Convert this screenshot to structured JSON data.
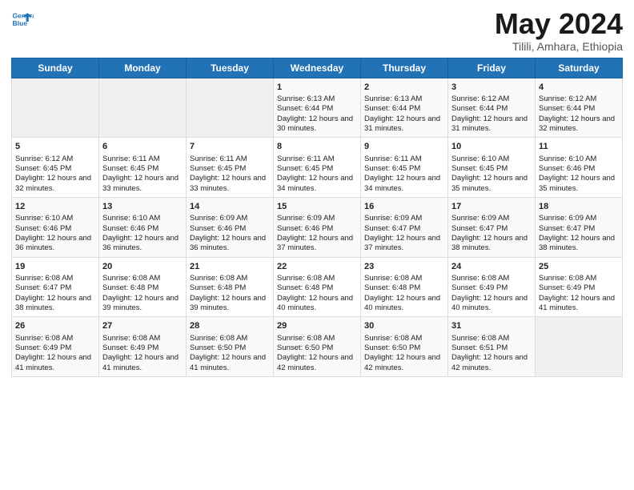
{
  "logo": {
    "line1": "General",
    "line2": "Blue"
  },
  "title": "May 2024",
  "subtitle": "Tilili, Amhara, Ethiopia",
  "days_of_week": [
    "Sunday",
    "Monday",
    "Tuesday",
    "Wednesday",
    "Thursday",
    "Friday",
    "Saturday"
  ],
  "weeks": [
    [
      {
        "day": null,
        "content": null
      },
      {
        "day": null,
        "content": null
      },
      {
        "day": null,
        "content": null
      },
      {
        "day": "1",
        "content": "Sunrise: 6:13 AM\nSunset: 6:44 PM\nDaylight: 12 hours and 30 minutes."
      },
      {
        "day": "2",
        "content": "Sunrise: 6:13 AM\nSunset: 6:44 PM\nDaylight: 12 hours and 31 minutes."
      },
      {
        "day": "3",
        "content": "Sunrise: 6:12 AM\nSunset: 6:44 PM\nDaylight: 12 hours and 31 minutes."
      },
      {
        "day": "4",
        "content": "Sunrise: 6:12 AM\nSunset: 6:44 PM\nDaylight: 12 hours and 32 minutes."
      }
    ],
    [
      {
        "day": "5",
        "content": "Sunrise: 6:12 AM\nSunset: 6:45 PM\nDaylight: 12 hours and 32 minutes."
      },
      {
        "day": "6",
        "content": "Sunrise: 6:11 AM\nSunset: 6:45 PM\nDaylight: 12 hours and 33 minutes."
      },
      {
        "day": "7",
        "content": "Sunrise: 6:11 AM\nSunset: 6:45 PM\nDaylight: 12 hours and 33 minutes."
      },
      {
        "day": "8",
        "content": "Sunrise: 6:11 AM\nSunset: 6:45 PM\nDaylight: 12 hours and 34 minutes."
      },
      {
        "day": "9",
        "content": "Sunrise: 6:11 AM\nSunset: 6:45 PM\nDaylight: 12 hours and 34 minutes."
      },
      {
        "day": "10",
        "content": "Sunrise: 6:10 AM\nSunset: 6:45 PM\nDaylight: 12 hours and 35 minutes."
      },
      {
        "day": "11",
        "content": "Sunrise: 6:10 AM\nSunset: 6:46 PM\nDaylight: 12 hours and 35 minutes."
      }
    ],
    [
      {
        "day": "12",
        "content": "Sunrise: 6:10 AM\nSunset: 6:46 PM\nDaylight: 12 hours and 36 minutes."
      },
      {
        "day": "13",
        "content": "Sunrise: 6:10 AM\nSunset: 6:46 PM\nDaylight: 12 hours and 36 minutes."
      },
      {
        "day": "14",
        "content": "Sunrise: 6:09 AM\nSunset: 6:46 PM\nDaylight: 12 hours and 36 minutes."
      },
      {
        "day": "15",
        "content": "Sunrise: 6:09 AM\nSunset: 6:46 PM\nDaylight: 12 hours and 37 minutes."
      },
      {
        "day": "16",
        "content": "Sunrise: 6:09 AM\nSunset: 6:47 PM\nDaylight: 12 hours and 37 minutes."
      },
      {
        "day": "17",
        "content": "Sunrise: 6:09 AM\nSunset: 6:47 PM\nDaylight: 12 hours and 38 minutes."
      },
      {
        "day": "18",
        "content": "Sunrise: 6:09 AM\nSunset: 6:47 PM\nDaylight: 12 hours and 38 minutes."
      }
    ],
    [
      {
        "day": "19",
        "content": "Sunrise: 6:08 AM\nSunset: 6:47 PM\nDaylight: 12 hours and 38 minutes."
      },
      {
        "day": "20",
        "content": "Sunrise: 6:08 AM\nSunset: 6:48 PM\nDaylight: 12 hours and 39 minutes."
      },
      {
        "day": "21",
        "content": "Sunrise: 6:08 AM\nSunset: 6:48 PM\nDaylight: 12 hours and 39 minutes."
      },
      {
        "day": "22",
        "content": "Sunrise: 6:08 AM\nSunset: 6:48 PM\nDaylight: 12 hours and 40 minutes."
      },
      {
        "day": "23",
        "content": "Sunrise: 6:08 AM\nSunset: 6:48 PM\nDaylight: 12 hours and 40 minutes."
      },
      {
        "day": "24",
        "content": "Sunrise: 6:08 AM\nSunset: 6:49 PM\nDaylight: 12 hours and 40 minutes."
      },
      {
        "day": "25",
        "content": "Sunrise: 6:08 AM\nSunset: 6:49 PM\nDaylight: 12 hours and 41 minutes."
      }
    ],
    [
      {
        "day": "26",
        "content": "Sunrise: 6:08 AM\nSunset: 6:49 PM\nDaylight: 12 hours and 41 minutes."
      },
      {
        "day": "27",
        "content": "Sunrise: 6:08 AM\nSunset: 6:49 PM\nDaylight: 12 hours and 41 minutes."
      },
      {
        "day": "28",
        "content": "Sunrise: 6:08 AM\nSunset: 6:50 PM\nDaylight: 12 hours and 41 minutes."
      },
      {
        "day": "29",
        "content": "Sunrise: 6:08 AM\nSunset: 6:50 PM\nDaylight: 12 hours and 42 minutes."
      },
      {
        "day": "30",
        "content": "Sunrise: 6:08 AM\nSunset: 6:50 PM\nDaylight: 12 hours and 42 minutes."
      },
      {
        "day": "31",
        "content": "Sunrise: 6:08 AM\nSunset: 6:51 PM\nDaylight: 12 hours and 42 minutes."
      },
      {
        "day": null,
        "content": null
      }
    ]
  ]
}
